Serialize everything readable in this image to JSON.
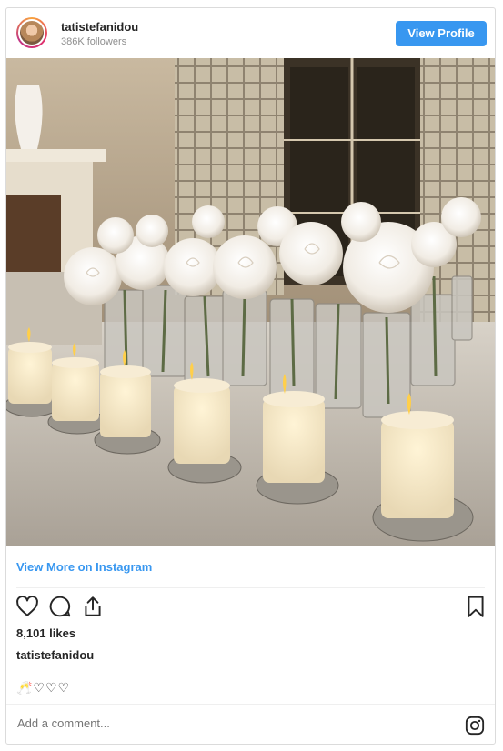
{
  "header": {
    "username": "tatistefanidou",
    "followers": "386K followers",
    "view_profile_label": "View Profile"
  },
  "photo": {
    "icon": "photo-candles-roses"
  },
  "more_link": "View More on Instagram",
  "actions": {
    "like_icon": "heart-icon",
    "comment_icon": "comment-icon",
    "share_icon": "share-icon",
    "save_icon": "bookmark-icon"
  },
  "likes": "8,101 likes",
  "caption": {
    "username": "tatistefanidou",
    "text": "🥂♡♡♡"
  },
  "comment": {
    "placeholder": "Add a comment..."
  },
  "colors": {
    "accent": "#3897f0",
    "text": "#262626",
    "muted": "#8e8e8e"
  }
}
